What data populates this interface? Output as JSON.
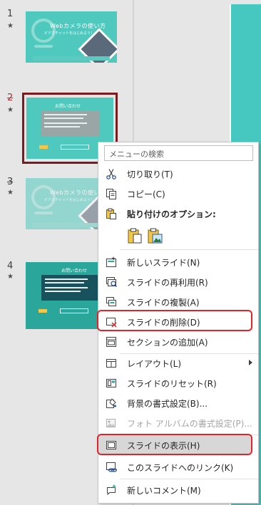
{
  "thumbnails": {
    "slide1": {
      "number": "1",
      "star": "★",
      "title": "Webカメラの使い方",
      "subtitle": "ビデオチャットをはじめよう！"
    },
    "slide2": {
      "number": "2",
      "star": "★",
      "title": "お問い合わせ"
    },
    "slide3": {
      "number": "3",
      "star": "★",
      "title": "Webカメラの使い方",
      "subtitle": "ビデオチャットをはじめよう！"
    },
    "slide4": {
      "number": "4",
      "star": "★",
      "title": "お問い合わせ"
    }
  },
  "context_menu": {
    "search_placeholder": "メニューの検索",
    "cut": "切り取り(T)",
    "copy": "コピー(C)",
    "paste_options": "貼り付けのオプション:",
    "new_slide": "新しいスライド(N)",
    "reuse_slides": "スライドの再利用(R)",
    "duplicate_slide": "スライドの複製(A)",
    "delete_slide": "スライドの削除(D)",
    "add_section": "セクションの追加(A)",
    "layout": "レイアウト(L)",
    "reset_slide": "スライドのリセット(R)",
    "format_background": "背景の書式設定(B)...",
    "format_photo_album": "フォト アルバムの書式設定(P)...",
    "show_slide": "スライドの表示(H)",
    "link_to_slide": "このスライドへのリンク(K)",
    "new_comment": "新しいコメント(M)"
  },
  "colors": {
    "accent_red": "#e0242b",
    "selection": "#7b1b1f",
    "slide_teal": "#4fc9bd"
  }
}
